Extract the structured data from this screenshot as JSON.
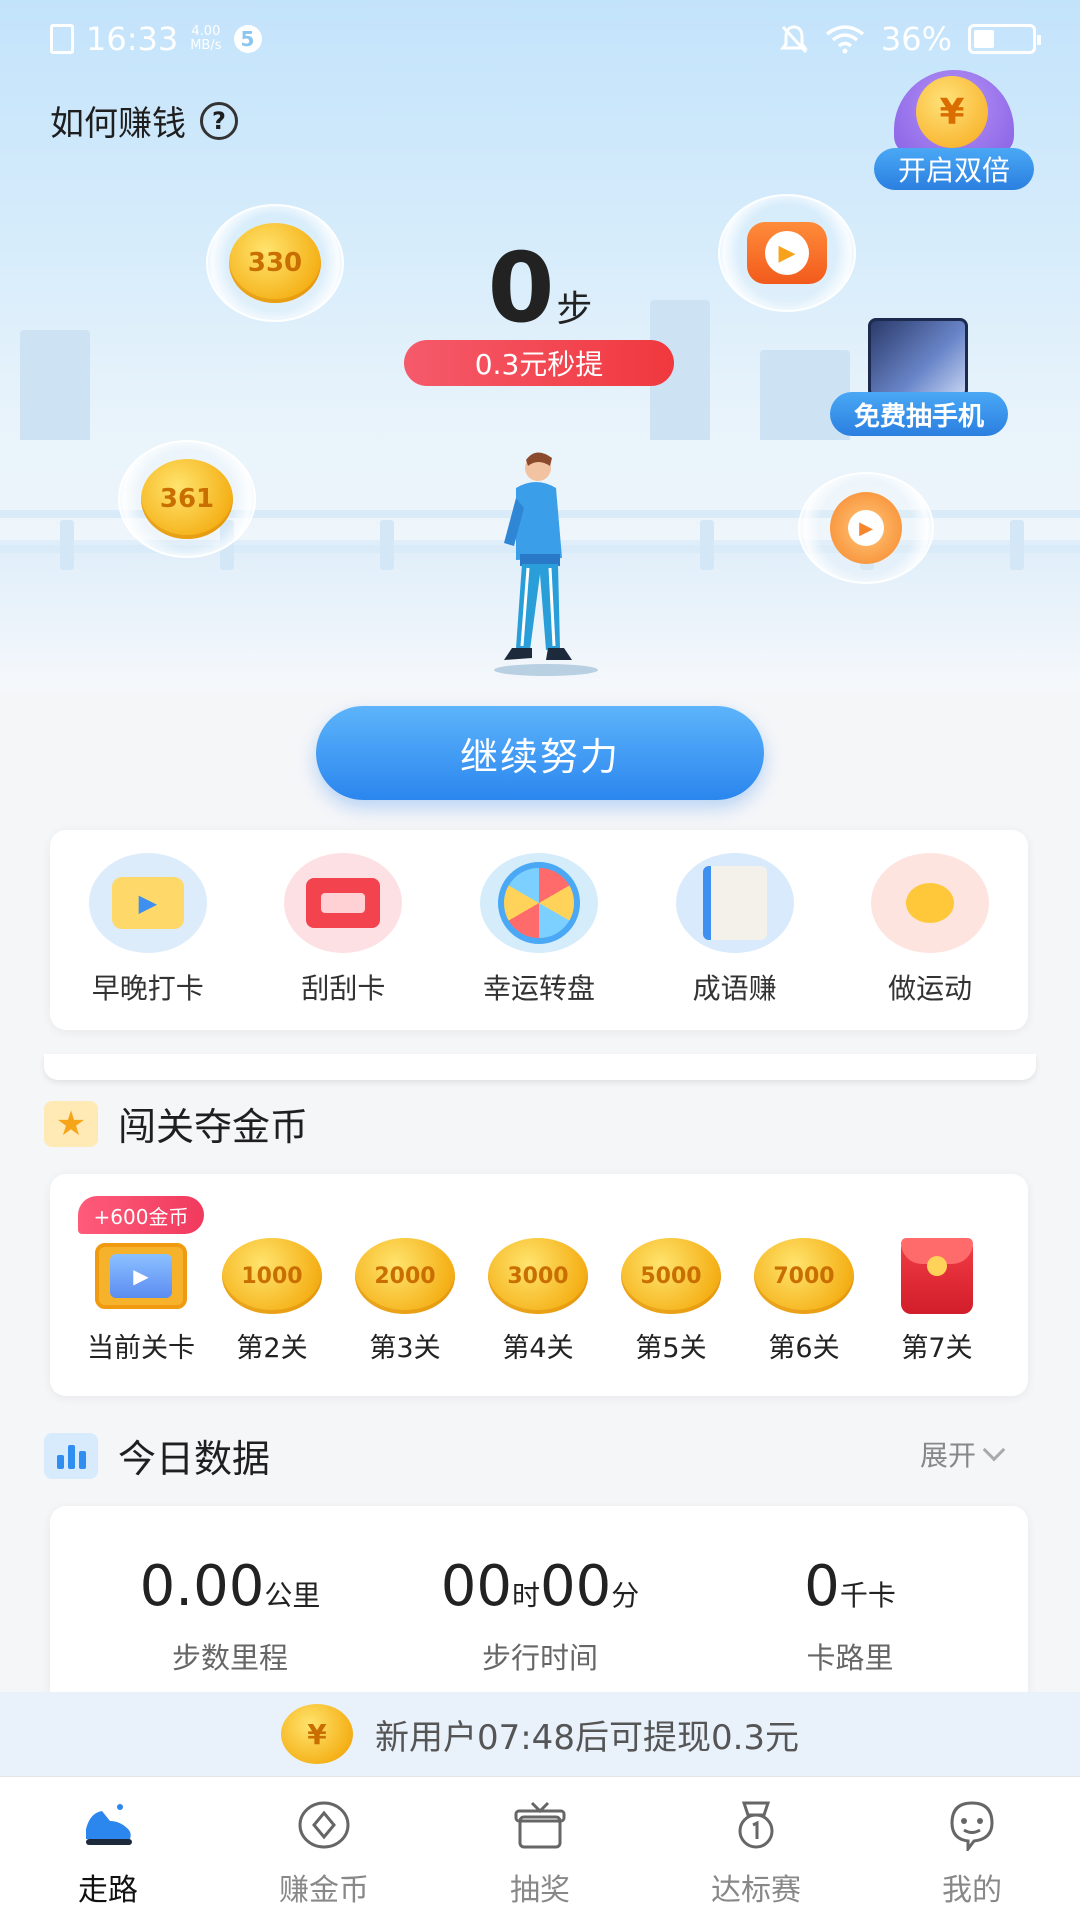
{
  "status_bar": {
    "time": "16:33",
    "net_speed_value": "4.00",
    "net_speed_unit": "MB/s",
    "sim_badge": "5",
    "battery": "36%",
    "battery_level": 0.36
  },
  "header": {
    "how_to_earn": "如何赚钱",
    "help_icon": "?",
    "double_coin_symbol": "¥",
    "double_label": "开启双倍"
  },
  "steps": {
    "count": "0",
    "unit": "步",
    "withdraw_pill": "0.3元秒提"
  },
  "bubbles": {
    "coin_1": "330",
    "coin_2": "361",
    "video_icon": "tv-play-icon",
    "alarm_icon": "alarm-clock-icon"
  },
  "phone_promo": {
    "label": "免费抽手机"
  },
  "continue_button": "继续努力",
  "tools": [
    {
      "label": "早晚打卡",
      "icon": "checkin-icon"
    },
    {
      "label": "刮刮卡",
      "icon": "scratch-card-icon"
    },
    {
      "label": "幸运转盘",
      "icon": "lucky-wheel-icon"
    },
    {
      "label": "成语赚",
      "icon": "idiom-book-icon"
    },
    {
      "label": "做运动",
      "icon": "exercise-icon"
    }
  ],
  "levels_section": {
    "title": "闯关夺金币",
    "reward_badge": "+600金币",
    "levels": [
      {
        "label": "当前关卡",
        "type": "tv"
      },
      {
        "label": "第2关",
        "coin": "1000"
      },
      {
        "label": "第3关",
        "coin": "2000"
      },
      {
        "label": "第4关",
        "coin": "3000"
      },
      {
        "label": "第5关",
        "coin": "5000"
      },
      {
        "label": "第6关",
        "coin": "7000"
      },
      {
        "label": "第7关",
        "type": "redpacket"
      }
    ]
  },
  "today": {
    "title": "今日数据",
    "expand": "展开",
    "distance_value": "0.00",
    "distance_unit": "公里",
    "distance_label": "步数里程",
    "time_hours": "00",
    "time_hours_unit": "时",
    "time_minutes": "00",
    "time_minutes_unit": "分",
    "time_label": "步行时间",
    "calories_value": "0",
    "calories_unit": "千卡",
    "calories_label": "卡路里"
  },
  "new_user_bar": {
    "coin_symbol": "¥",
    "text": "新用户07:48后可提现0.3元"
  },
  "tabbar": [
    {
      "label": "走路",
      "icon": "shoe-icon",
      "active": true
    },
    {
      "label": "赚金币",
      "icon": "coin-diamond-icon",
      "active": false
    },
    {
      "label": "抽奖",
      "icon": "gift-box-icon",
      "active": false
    },
    {
      "label": "达标赛",
      "icon": "medal-icon",
      "active": false
    },
    {
      "label": "我的",
      "icon": "profile-face-icon",
      "active": false
    }
  ],
  "colors": {
    "primary_blue": "#2b86ee",
    "pill_red": "#f0383e",
    "coin_gold": "#f5b21a"
  }
}
